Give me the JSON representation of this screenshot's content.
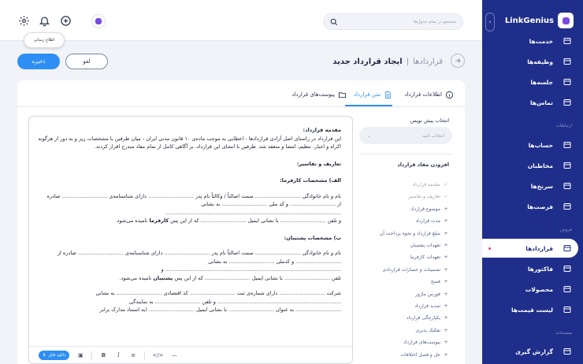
{
  "topbar": {
    "search_placeholder": "جستجو در تمام جدول‌ها",
    "tooltip": "اطلاع رسانی"
  },
  "header": {
    "breadcrumb_parent": "قراردادها",
    "separator": "|",
    "title": "ایجاد قرارداد جدید",
    "save_label": "ذخیره",
    "cancel_label": "لغو"
  },
  "tabs": [
    {
      "label": "اطلاعات قرارداد",
      "icon": "info-icon"
    },
    {
      "label": "متن قرارداد",
      "icon": "document-icon",
      "active": true
    },
    {
      "label": "پیوست‌های قرارداد",
      "icon": "folder-icon"
    }
  ],
  "document": {
    "intro_heading": "مقدمه قرارداد:",
    "intro_text": "این قرارداد در راستای اصل آزادی قراردادها - اعطایی به موجب ماده‌ی ۱۰ قانون مدنی ایران - میان طرفین با مشخصات زیر و به دور از هرگونه اکراه و اجبار، تنظیم، امضا و منعقد شد. طرفین با انشای این قرارداد، بر آگاهی کامل از تمام مفاد مندرج اقرار کردند.",
    "definitions_heading": "تعاریف و تفاسیر:",
    "employer_heading": "الف) مشخصات کارفرما:",
    "employer_line1": "نام و نام خانوادگی ............................ سمت اصالتاً / وکالتاً نام پدر ............................ دارای شناسنامه‌ی ............................ صادره",
    "employer_line2": "از ............................ و کد ملی ............................ به نشانی ............................................................................................................",
    "employer_line3_pre": "و تلفن ............................ با نشانی ایمیل ............................ که از این پس",
    "employer_bold": "کارفرما",
    "employer_line3_post": "نامیده می‌شود.",
    "support_heading": "ب) مشخصات پشتیبان:",
    "support_line1": "نام و نام خانوادگی ............................ سمت اصالتاً نام پدر ............................ دارای شناسنامه‌ی ............................ صادره از",
    "support_line2": "............................ و کدملی ............................ به نشانی ............................................................................................................ و",
    "support_line3_pre": "تلفن ............................ با نشانی ایمیل ............................ که از این پس",
    "support_bold": "پشتیبان",
    "support_line3_post": "نامیده می‌شود.",
    "company_line1": "شرکت ............................ دارای شماره‌ی ثبت ............................ کد اقتصادی ............................ به نشانی",
    "company_line2": "............................................................................ و تلفن ............................ به نمایندگی",
    "company_line3": "............................ به عنوان ............................ با نشانی ایمیل ............................ (به استناد مدارک برابر"
  },
  "toolbar": {
    "file_label": "دانلود فایل",
    "bold": "B",
    "italic": "I",
    "list": "≡",
    "code": "</>",
    "hr": "—"
  },
  "side": {
    "pretext_label": "انتخاب پیش نویس",
    "select_placeholder": "انتخاب کنید",
    "clauses_label": "افزودن مفاد قرارداد",
    "clauses": [
      {
        "label": "مقدمه قرارداد",
        "done": true
      },
      {
        "label": "تعاریف و تفاسیر",
        "done": true
      },
      {
        "label": "موضوع قرارداد",
        "done": false
      },
      {
        "label": "مدت قرارداد",
        "done": false
      },
      {
        "label": "مبلغ قرارداد و نحوه پرداخت آن",
        "done": false
      },
      {
        "label": "تعهدات پشتیبان",
        "done": false
      },
      {
        "label": "تعهدات کارفرما",
        "done": false
      },
      {
        "label": "تضمینات و خسارات قراردادی",
        "done": false
      },
      {
        "label": "فسخ",
        "done": false
      },
      {
        "label": "فورس ماژور",
        "done": false
      },
      {
        "label": "تمدید قرارداد",
        "done": false
      },
      {
        "label": "یکپارچگی قرارداد",
        "done": false
      },
      {
        "label": "تفکیک پذیری",
        "done": false
      },
      {
        "label": "پیوست‌های قرارداد",
        "done": false
      },
      {
        "label": "حل و فصل اختلافات",
        "done": false
      },
      {
        "label": "نسخ قرارداد",
        "done": false
      }
    ]
  },
  "sidebar": {
    "brand": "LinkGenius",
    "collapse": "‹",
    "items_top": [
      {
        "label": "خدمت‌ها",
        "icon": "services-icon"
      },
      {
        "label": "وظیفه‌ها",
        "icon": "tasks-icon"
      },
      {
        "label": "جلسه‌ها",
        "icon": "meetings-icon"
      },
      {
        "label": "تماس‌ها",
        "icon": "calls-icon"
      }
    ],
    "section_relations": "ارتباطات",
    "items_relations": [
      {
        "label": "حساب‌ها",
        "icon": "accounts-icon"
      },
      {
        "label": "مخاطبان",
        "icon": "contacts-icon"
      },
      {
        "label": "سرنخ‌ها",
        "icon": "leads-icon"
      },
      {
        "label": "فرصت‌ها",
        "icon": "opportunities-icon"
      }
    ],
    "section_sales": "فروش",
    "items_sales": [
      {
        "label": "قراردادها",
        "icon": "contracts-icon",
        "active": true
      },
      {
        "label": "فاکتورها",
        "icon": "invoices-icon"
      },
      {
        "label": "محصولات",
        "icon": "products-icon"
      },
      {
        "label": "لیست قیمت‌ها",
        "icon": "pricelist-icon"
      }
    ],
    "section_docs": "مستندات",
    "items_docs": [
      {
        "label": "گزارش گیری",
        "icon": "reports-icon"
      }
    ]
  },
  "colors": {
    "accent": "#2d8ff3",
    "sidebar": "#1f2e8a",
    "active_dot": "#e0447a"
  }
}
